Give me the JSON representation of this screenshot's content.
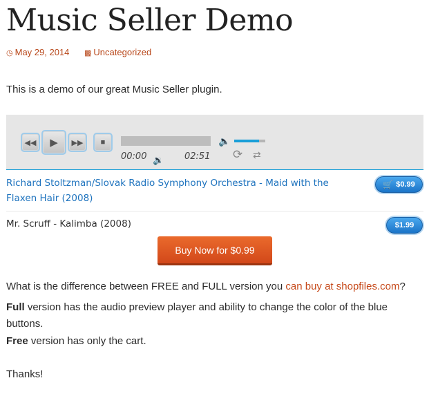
{
  "post": {
    "title": "Music Seller Demo",
    "date": "May 29, 2014",
    "category": "Uncategorized",
    "intro": "This is a demo of our great Music Seller plugin."
  },
  "player": {
    "current_time": "00:00",
    "duration": "02:51",
    "volume_level": 0.8,
    "progress": 0
  },
  "tracks": [
    {
      "title": "Richard Stoltzman/Slovak Radio Symphony Orchestra - Maid with the Flaxen Hair (2008)",
      "price": "$0.99"
    },
    {
      "title": "Mr. Scruff - Kalimba (2008)",
      "price": "$1.99"
    }
  ],
  "buy_button": "Buy Now for $0.99",
  "body": {
    "question": "What is the difference between FREE and FULL version you ",
    "link": "can buy at shopfiles.com",
    "question_end": "?",
    "full_bold": "Full",
    "full_text": " version has the audio preview player and ability to change the color of the blue buttons.",
    "free_bold": "Free",
    "free_text": " version has only the cart.",
    "thanks": "Thanks!"
  },
  "colors": {
    "accent": "#c6491a",
    "link": "#1e73be",
    "player_blue": "#1a9fd8",
    "buy": "#d9501e"
  },
  "icons": [
    "clock-icon",
    "folder-icon",
    "rewind-icon",
    "play-icon",
    "fast-forward-icon",
    "stop-icon",
    "volume-icon",
    "mute-icon",
    "repeat-icon",
    "shuffle-icon",
    "cart-icon"
  ]
}
